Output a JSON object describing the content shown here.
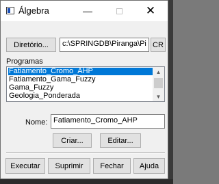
{
  "window": {
    "title": "Álgebra"
  },
  "titlebar": {
    "minimize_symbol": "—",
    "close_symbol": "✕"
  },
  "directory": {
    "button_label": "Diretório...",
    "path_value": "c:\\SPRINGDB\\Piranga\\Pi",
    "cr_button_label": "CR"
  },
  "programs": {
    "label": "Programas",
    "items": [
      {
        "label": "Fatiamento_Cromo_AHP",
        "selected": true
      },
      {
        "label": "Fatiamento_Gama_Fuzzy",
        "selected": false
      },
      {
        "label": "Gama_Fuzzy",
        "selected": false
      },
      {
        "label": "Geologia_Ponderada",
        "selected": false
      }
    ]
  },
  "name": {
    "label": "Nome:",
    "value": "Fatiamento_Cromo_AHP"
  },
  "actions": {
    "create_label": "Criar...",
    "edit_label": "Editar..."
  },
  "footer": {
    "execute_label": "Executar",
    "delete_label": "Suprimir",
    "close_label": "Fechar",
    "help_label": "Ajuda"
  },
  "colors": {
    "selection": "#0078d7",
    "window_bg": "#f0f0f0"
  }
}
